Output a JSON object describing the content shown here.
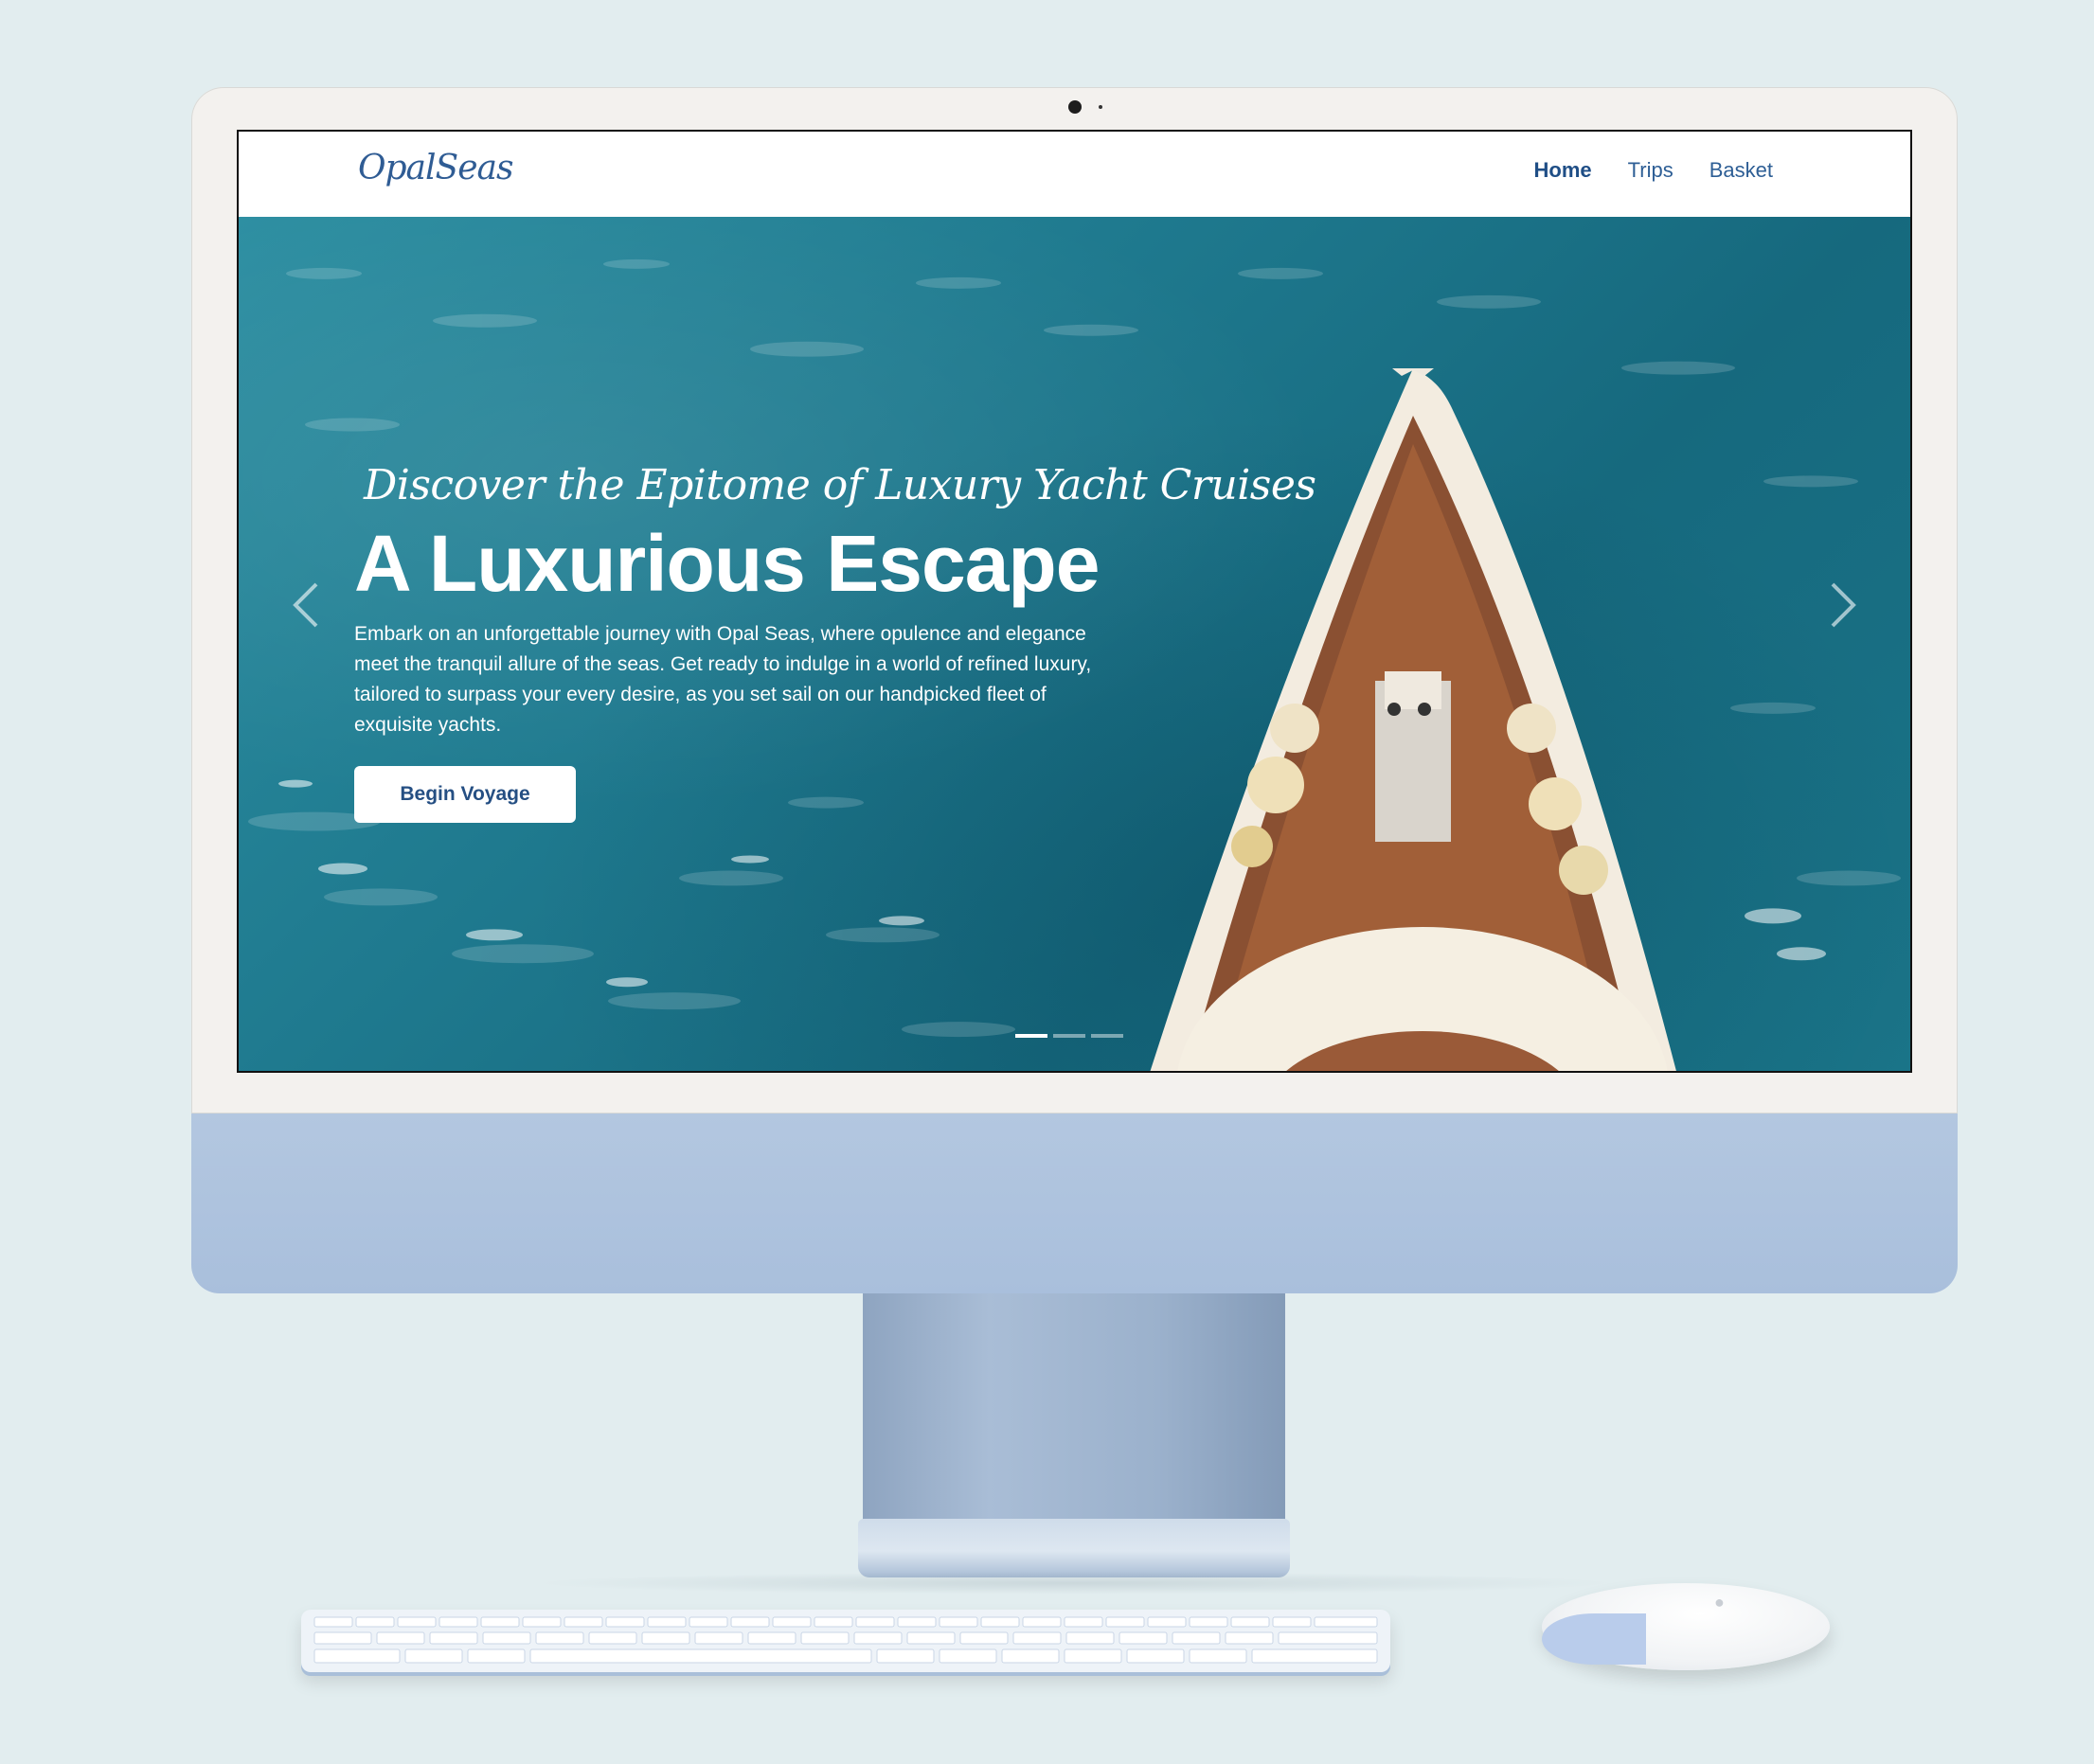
{
  "site": {
    "logo": "OpalSeas"
  },
  "nav": {
    "items": [
      {
        "label": "Home",
        "active": true
      },
      {
        "label": "Trips",
        "active": false
      },
      {
        "label": "Basket",
        "active": false
      }
    ]
  },
  "hero": {
    "subtitle": "Discover the Epitome of Luxury Yacht Cruises",
    "title": "A Luxurious Escape",
    "description": "Embark on an unforgettable journey with Opal Seas, where opulence and elegance meet the tranquil allure of the seas. Get ready to indulge in a world of refined luxury, tailored to surpass your every desire, as you set sail on our handpicked fleet of exquisite yachts.",
    "cta_label": "Begin Voyage",
    "slide_count": 3,
    "active_slide": 1
  },
  "icons": {
    "prev": "chevron-left-icon",
    "next": "chevron-right-icon",
    "device_logo": "apple-logo-icon"
  },
  "colors": {
    "page_background": "#e2edef",
    "accent": "#2d5e95",
    "sea": "#1f7a8f",
    "device_blue": "#adc2dd"
  }
}
